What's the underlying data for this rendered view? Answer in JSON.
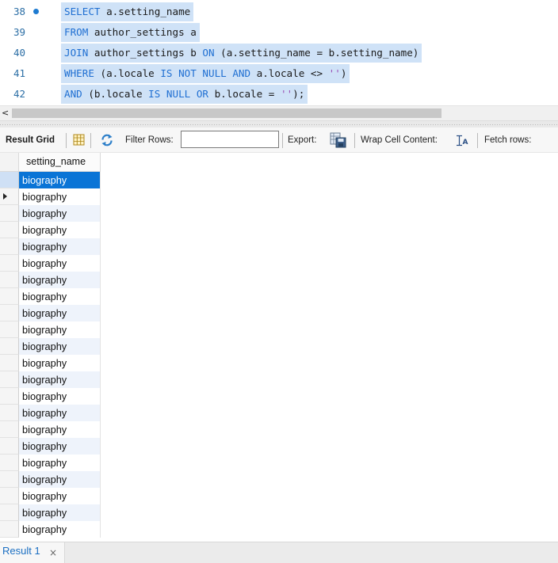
{
  "editor": {
    "lines": [
      {
        "number": "38",
        "executed": true
      },
      {
        "number": "39",
        "executed": false
      },
      {
        "number": "40",
        "executed": false
      },
      {
        "number": "41",
        "executed": false
      },
      {
        "number": "42",
        "executed": false
      }
    ],
    "sql": {
      "l38_kw": "SELECT",
      "l38_rest": " a.setting_name",
      "l39_kw": "FROM",
      "l39_rest": " author_settings a",
      "l40_kw": "JOIN",
      "l40_mid": " author_settings b ",
      "l40_kw2": "ON",
      "l40_rest": " (a.setting_name = b.setting_name)",
      "l41_kw": "WHERE",
      "l41_a": " (a.locale ",
      "l41_kw2": "IS NOT NULL AND",
      "l41_b": " a.locale <> ",
      "l41_str": "''",
      "l41_c": ")",
      "l42_kw": "AND",
      "l42_a": " (b.locale ",
      "l42_kw2": "IS NULL OR",
      "l42_b": " b.locale = ",
      "l42_str": "''",
      "l42_c": ");"
    },
    "selection_color": "#cfe2f7",
    "keyword_color": "#1f6fd2"
  },
  "scrollbar": {
    "left_glyph": "<"
  },
  "toolbar": {
    "result_grid_label": "Result Grid",
    "filter_rows_label": "Filter Rows:",
    "filter_value": "",
    "export_label": "Export:",
    "wrap_label": "Wrap Cell Content:",
    "fetch_label": "Fetch rows:",
    "icons": [
      "grid-view-icon",
      "refresh-icon",
      "export-icon",
      "wrap-text-icon"
    ]
  },
  "grid": {
    "column_header": "setting_name",
    "selected_row_index": 0,
    "current_row_index": 1,
    "selection_color": "#0a74d6",
    "rows": [
      "biography",
      "biography",
      "biography",
      "biography",
      "biography",
      "biography",
      "biography",
      "biography",
      "biography",
      "biography",
      "biography",
      "biography",
      "biography",
      "biography",
      "biography",
      "biography",
      "biography",
      "biography",
      "biography",
      "biography",
      "biography",
      "biography"
    ]
  },
  "tabs": {
    "result_tab_label": "Result 1",
    "close_glyph": "×"
  }
}
